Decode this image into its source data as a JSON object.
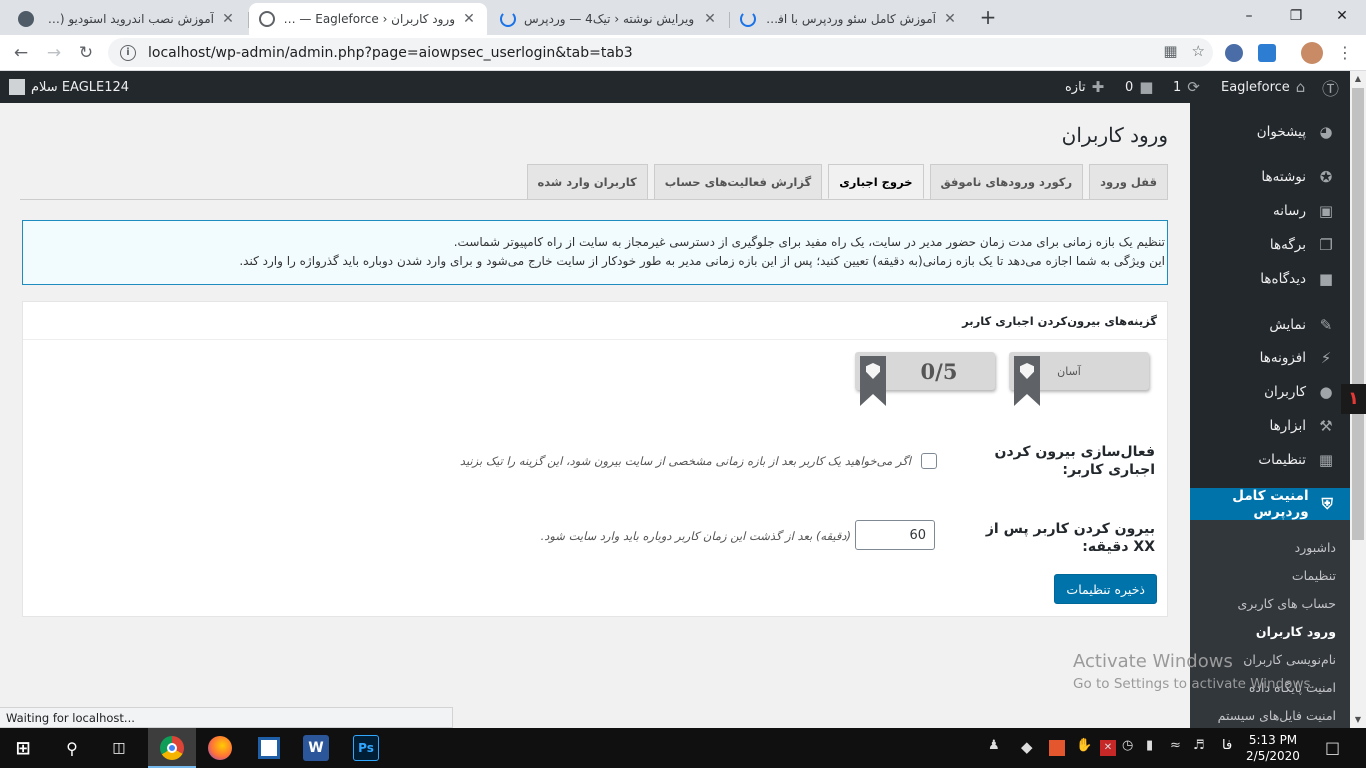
{
  "browser": {
    "tabs": [
      {
        "title": "آموزش نصب اندروید استودیو (Studio",
        "favicon": "wp-icon",
        "active": false
      },
      {
        "title": "ورود کاربران ‹ Eagleforce — وردپرس",
        "favicon": "globe-icon",
        "active": true
      },
      {
        "title": "ویرایش نوشته ‹ تیک4 — وردپرس",
        "favicon": "loading-icon",
        "active": false
      },
      {
        "title": "آموزش کامل سئو وردپرس با افزونه",
        "favicon": "loading-icon",
        "active": false
      }
    ],
    "close_glyph": "✕",
    "new_tab_glyph": "+",
    "url": "localhost/wp-admin/admin.php?page=aiowpsec_userlogin&tab=tab3",
    "status_text": "Waiting for localhost..."
  },
  "adminbar": {
    "greeting": "سلام EAGLE124",
    "site_name": "Eagleforce",
    "updates_count": "1",
    "comments_count": "0",
    "new_label": "تازه"
  },
  "sidebar": {
    "menu": [
      {
        "label": "پیشخوان",
        "icon": "dashboard-icon"
      },
      {
        "label": "نوشته‌ها",
        "icon": "pin-icon"
      },
      {
        "label": "رسانه",
        "icon": "media-icon"
      },
      {
        "label": "برگه‌ها",
        "icon": "pages-icon"
      },
      {
        "label": "دیدگاه‌ها",
        "icon": "comments-icon"
      },
      {
        "label": "نمایش",
        "icon": "appearance-icon"
      },
      {
        "label": "افزونه‌ها",
        "icon": "plugins-icon"
      },
      {
        "label": "کاربران",
        "icon": "users-icon"
      },
      {
        "label": "ابزارها",
        "icon": "tools-icon"
      },
      {
        "label": "تنظیمات",
        "icon": "settings-icon"
      }
    ],
    "current": {
      "label": "امنیت کامل وردپرس",
      "icon": "shield-icon"
    },
    "submenu": [
      {
        "label": "داشبورد",
        "active": false
      },
      {
        "label": "تنظیمات",
        "active": false
      },
      {
        "label": "حساب های کاربری",
        "active": false
      },
      {
        "label": "ورود کاربران",
        "active": true
      },
      {
        "label": "نام‌نویسی کاربران",
        "active": false
      },
      {
        "label": "امنیت پایگاه داده",
        "active": false
      },
      {
        "label": "امنیت فایل‌های سیستم",
        "active": false
      }
    ]
  },
  "page": {
    "title": "ورود کاربران",
    "tabs": [
      {
        "label": "قفل ورود",
        "active": false
      },
      {
        "label": "رکورد ورودهای ناموفق",
        "active": false
      },
      {
        "label": "خروج اجباری",
        "active": true
      },
      {
        "label": "گزارش فعالیت‌های حساب",
        "active": false
      },
      {
        "label": "کاربران وارد شده",
        "active": false
      }
    ],
    "notice": {
      "line1": "تنظیم یک بازه زمانی برای مدت زمان حضور مدیر در سایت، یک راه مفید برای جلوگیری از دسترسی غیرمجاز به سایت از راه کامپیوتر شماست.",
      "line2": "این ویژگی به شما اجازه می‌دهد تا یک بازه زمانی(به دقیقه) تعیین کنید؛ پس از این بازه زمانی مدیر به طور خودکار از سایت خارج می‌شود و برای وارد شدن دوباره باید گذرواژه را وارد کند."
    },
    "postbox": {
      "title": "گزینه‌های بیرون‌کردن اجباری کاربر",
      "difficulty": "آسان",
      "score": "0/5",
      "enable_label": "فعال‌سازی بیرون کردن اجباری کاربر:",
      "enable_desc": "اگر می‌خواهید یک کاربر بعد از بازه زمانی مشخصی از سایت بیرون شود، این گزینه را تیک بزنید",
      "enable_checked": false,
      "minutes_label": "بیرون کردن کاربر پس از XX دقیقه:",
      "minutes_value": "60",
      "minutes_desc": "(دقیقه) بعد از گذشت این زمان کاربر دوباره باید وارد سایت شود.",
      "save_label": "ذخیره تنظیمات"
    }
  },
  "watermark": {
    "line1": "Activate Windows",
    "line2": "Go to Settings to activate Windows."
  },
  "taskbar": {
    "time": "5:13 PM",
    "date": "2/5/2020",
    "lang": "فا",
    "apps": [
      "chrome-icon",
      "firefox-icon",
      "terminal-icon",
      "word-icon",
      "photoshop-icon"
    ],
    "word_glyph": "W",
    "ps_glyph": "Ps"
  },
  "overlay_badge": "۱",
  "colors": {
    "wp_dark": "#23282d",
    "wp_blue": "#0073aa",
    "submenu_bg": "#32373c",
    "notice_border": "#1e8cbe"
  }
}
